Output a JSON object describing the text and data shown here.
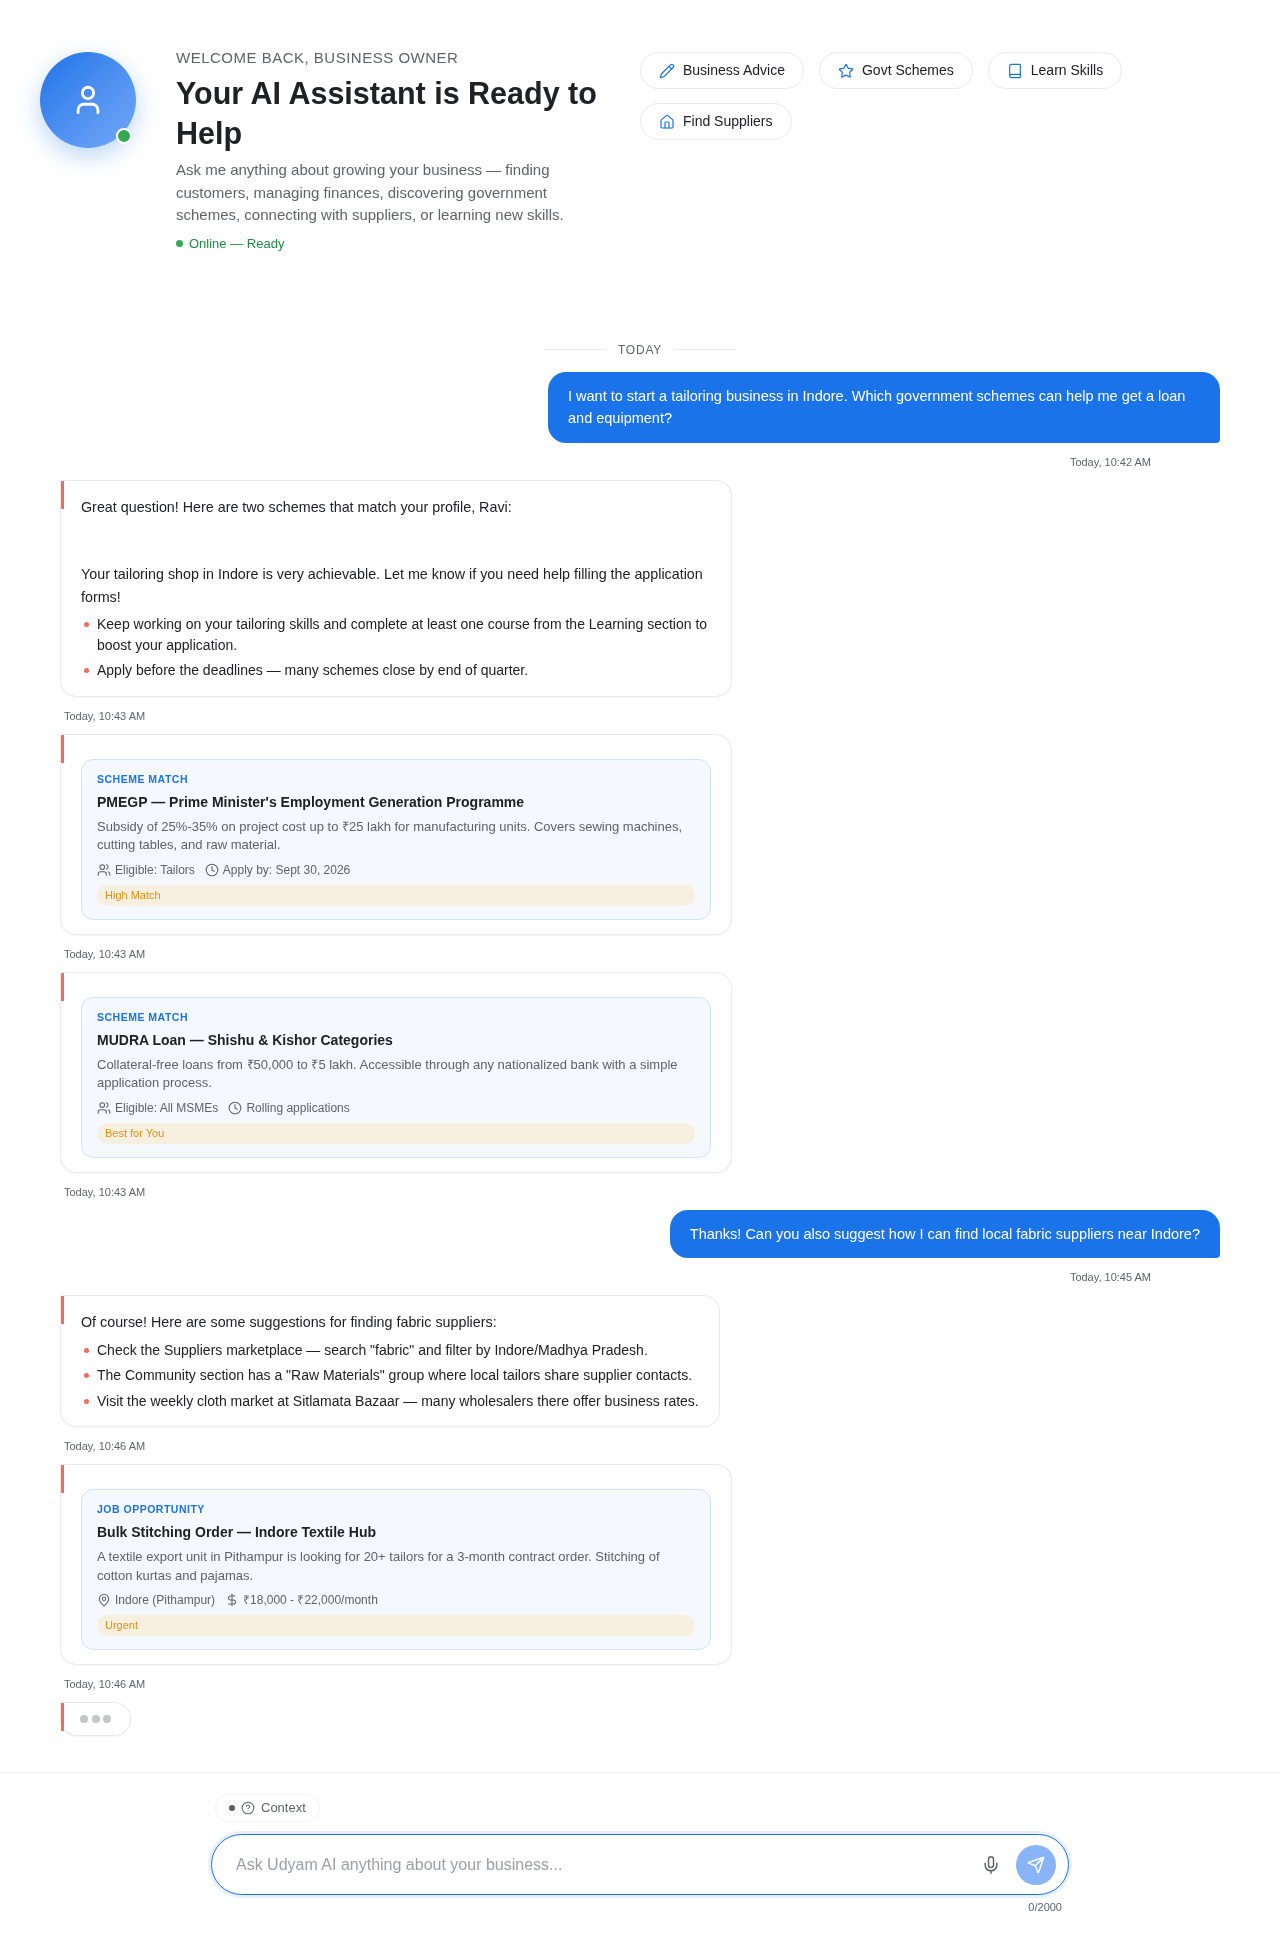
{
  "header": {
    "greeting": "WELCOME BACK, BUSINESS OWNER",
    "title": "Your AI Assistant is Ready to Help",
    "description": "Ask me anything about growing your business — finding customers, managing finances, discovering government schemes, connecting with suppliers, or learning new skills.",
    "status": {
      "label": "Online — Ready",
      "online": true
    }
  },
  "quick_actions": [
    {
      "label": "Business Advice"
    },
    {
      "label": "Govt Schemes"
    },
    {
      "label": "Learn Skills"
    },
    {
      "label": "Find Suppliers"
    }
  ],
  "chat": {
    "date_divider": "TODAY",
    "messages": [
      {
        "kind": "user",
        "text": "I want to start a tailoring business in Indore. Which government schemes can help me get a loan and equipment?",
        "time": "Today, 10:42 AM"
      },
      {
        "kind": "assistant",
        "paragraphs": [
          "Great question! Here are two schemes that match your profile, Ravi:",
          "Your tailoring shop in Indore is very achievable. Let me know if you need help filling the application forms!"
        ],
        "bullets": [
          "Keep working on your tailoring skills and complete at least one course from the Learning section to boost your application.",
          "Apply before the deadlines — many schemes close by end of quarter."
        ],
        "time": "Today, 10:43 AM"
      },
      {
        "kind": "card",
        "card": {
          "kind": "scheme",
          "category": "SCHEME MATCH",
          "title": "PMEGP — Prime Minister's Employment Generation Programme",
          "description": "Subsidy of 25%-35% on project cost up to ₹25 lakh for manufacturing units. Covers sewing machines, cutting tables, and raw material.",
          "meta": [
            "Eligible: Tailors",
            "Apply by: Sept 30, 2026"
          ],
          "tag": "High Match"
        },
        "time": "Today, 10:43 AM"
      },
      {
        "kind": "card",
        "card": {
          "kind": "scheme",
          "category": "SCHEME MATCH",
          "title": "MUDRA Loan — Shishu & Kishor Categories",
          "description": "Collateral-free loans from ₹50,000 to ₹5 lakh. Accessible through any nationalized bank with a simple application process.",
          "meta": [
            "Eligible: All MSMEs",
            "Rolling applications"
          ],
          "tag": "Best for You"
        },
        "time": "Today, 10:43 AM"
      },
      {
        "kind": "user",
        "text": "Thanks! Can you also suggest how I can find local fabric suppliers near Indore?",
        "time": "Today, 10:45 AM"
      },
      {
        "kind": "assistant",
        "paragraphs": [
          "Of course! Here are some suggestions for finding fabric suppliers:"
        ],
        "bullets": [
          "Check the Suppliers marketplace — search \"fabric\" and filter by Indore/Madhya Pradesh.",
          "The Community section has a \"Raw Materials\" group where local tailors share supplier contacts.",
          "Visit the weekly cloth market at Sitlamata Bazaar — many wholesalers there offer business rates."
        ],
        "time": "Today, 10:46 AM"
      },
      {
        "kind": "card",
        "card": {
          "kind": "job",
          "category": "JOB OPPORTUNITY",
          "title": "Bulk Stitching Order — Indore Textile Hub",
          "description": "A textile export unit in Pithampur is looking for 20+ tailors for a 3-month contract order. Stitching of cotton kurtas and pajamas.",
          "meta": [
            "Indore (Pithampur)",
            "₹18,000 - ₹22,000/month"
          ],
          "tag": "Urgent"
        },
        "time": "Today, 10:46 AM"
      },
      {
        "kind": "typing"
      }
    ]
  },
  "composer": {
    "context_label": "Context",
    "placeholder": "Ask Udyam AI anything about your business...",
    "counter": "0/2000",
    "send_disabled": true
  }
}
